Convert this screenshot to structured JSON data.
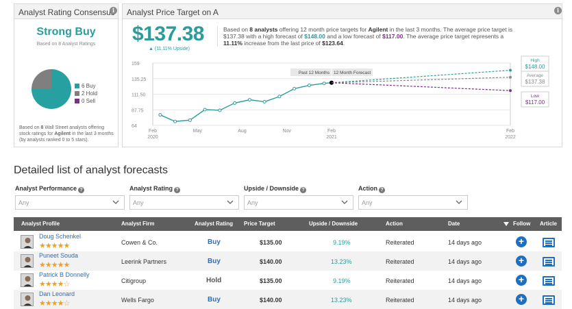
{
  "consensus": {
    "header": "Analyst Rating Consensus",
    "rating": "Strong Buy",
    "subtitle": "Based on 8 Analyst Ratings",
    "legend": [
      {
        "label": "6 Buy",
        "value": 6,
        "color": "#26a0a0"
      },
      {
        "label": "2 Hold",
        "value": 2,
        "color": "#7f7f7f"
      },
      {
        "label": "0 Sell",
        "value": 0,
        "color": "#7b2d8e"
      }
    ],
    "foot_pre": "Based on ",
    "foot_count": "8",
    "foot_mid": " Wall Street analysts offering stock ratings for ",
    "foot_company": "Agilent",
    "foot_post": " in the last 3 months (by analysts ranked 0 to 5 stars)."
  },
  "price_target": {
    "header": "Analyst Price Target on A",
    "price": "$137.38",
    "upside": "▲ (11.11% Upside)",
    "desc": {
      "t1": "Based on ",
      "analysts": "8 analysts",
      "t2": " offering 12 month price targets for ",
      "company": "Agilent",
      "t3": " in the last 3 months. The average price target is $137.38 with a high forecast of ",
      "high": "$148.00",
      "t4": " and a low forecast of ",
      "low": "$117.00",
      "t5": ". The average price target represents a ",
      "pct": "11.11%",
      "t6": " increase from the last price of ",
      "last": "$123.64",
      "t7": "."
    }
  },
  "chart_data": {
    "type": "line",
    "y_ticks": [
      "159",
      "135.25",
      "111.50",
      "87.75",
      "64"
    ],
    "ylim": [
      64,
      159
    ],
    "x_ticks": [
      {
        "label": "Feb",
        "sub": "2020",
        "x": 0
      },
      {
        "label": "May",
        "sub": "",
        "x": 3
      },
      {
        "label": "Aug",
        "sub": "",
        "x": 6
      },
      {
        "label": "Nov",
        "sub": "",
        "x": 9
      },
      {
        "label": "Feb",
        "sub": "2021",
        "x": 12
      },
      {
        "label": "Feb",
        "sub": "2022",
        "x": 24
      }
    ],
    "past_label": "Past 12 Months",
    "forecast_label": "12 Month Forecast",
    "history": {
      "x": [
        0.5,
        1.5,
        2.5,
        3.5,
        4.5,
        5.5,
        6.5,
        7.5,
        8.5,
        9.5,
        10.5,
        11.5,
        12
      ],
      "y": [
        80,
        70,
        72,
        88,
        87,
        98,
        103,
        100,
        108,
        120,
        125,
        128,
        129
      ]
    },
    "series": [
      {
        "name": "High",
        "value": 148.0,
        "value_label": "$148.00",
        "color": "#2a9c9c"
      },
      {
        "name": "Average",
        "value": 137.38,
        "value_label": "$137.38",
        "color": "#888888"
      },
      {
        "name": "Low",
        "value": 117.0,
        "value_label": "$117.00",
        "color": "#7b2d8e"
      }
    ]
  },
  "list": {
    "title": "Detailed list of analyst forecasts",
    "filters": [
      {
        "label": "Analyst Performance",
        "value": "Any"
      },
      {
        "label": "Analyst Rating",
        "value": "Any"
      },
      {
        "label": "Upside / Downside",
        "value": "Any"
      },
      {
        "label": "Action",
        "value": "Any"
      }
    ],
    "columns": [
      "Analyst Profile",
      "Analyst Firm",
      "Analyst Rating",
      "Price Target",
      "Upside / Downside",
      "Action",
      "Date",
      "Follow",
      "Article"
    ],
    "rows": [
      {
        "name": "Doug Schenkel",
        "stars": "★★★★★",
        "firm": "Cowen & Co.",
        "rating": "Buy",
        "target": "$135.00",
        "upside": "9.19%",
        "action": "Reiterated",
        "date": "14 days ago"
      },
      {
        "name": "Puneet Souda",
        "stars": "★★★★★",
        "firm": "Leerink Partners",
        "rating": "Buy",
        "target": "$140.00",
        "upside": "13.23%",
        "action": "Reiterated",
        "date": "14 days ago"
      },
      {
        "name": "Patrick B Donnelly",
        "stars": "★★★★☆",
        "firm": "Citigroup",
        "rating": "Hold",
        "target": "$135.00",
        "upside": "9.19%",
        "action": "Reiterated",
        "date": "14 days ago"
      },
      {
        "name": "Dan Leonard",
        "stars": "★★★★☆",
        "firm": "Wells Fargo",
        "rating": "Buy",
        "target": "$140.00",
        "upside": "13.23%",
        "action": "Reiterated",
        "date": "14 days ago"
      }
    ]
  }
}
